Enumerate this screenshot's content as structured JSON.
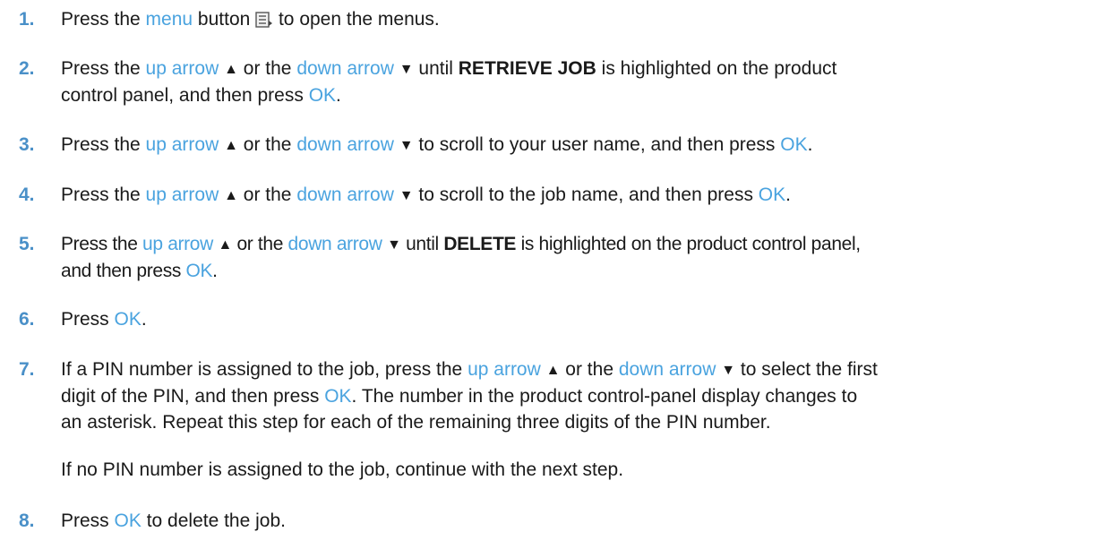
{
  "steps": [
    {
      "num": "1.",
      "t1": "Press the ",
      "link1": "menu",
      "t2": " button ",
      "t3": " to open the menus.",
      "icon": "menu-icon"
    },
    {
      "num": "2.",
      "t1": "Press the ",
      "link1": "up arrow",
      "t2": " or the ",
      "link2": "down arrow",
      "t3": " until ",
      "bold": "RETRIEVE JOB",
      "t4": " is highlighted on the product",
      "line2": "control panel, and then press ",
      "ok": "OK",
      "end": "."
    },
    {
      "num": "3.",
      "t1": "Press the ",
      "link1": "up arrow",
      "t2": " or the ",
      "link2": "down arrow",
      "t3": " to scroll to your user name, and then press ",
      "ok": "OK",
      "end": "."
    },
    {
      "num": "4.",
      "t1": "Press the ",
      "link1": "up arrow",
      "t2": " or the ",
      "link2": "down arrow",
      "t3": " to scroll to the job name, and then press ",
      "ok": "OK",
      "end": "."
    },
    {
      "num": "5.",
      "t1": "Press the ",
      "link1": "up arrow",
      "t2": " or the ",
      "link2": "down arrow",
      "t3": " until ",
      "bold": "DELETE",
      "t4": " is highlighted on the product control panel,",
      "line2": "and then press ",
      "ok": "OK",
      "end": "."
    },
    {
      "num": "6.",
      "t1": "Press ",
      "ok": "OK",
      "end": "."
    },
    {
      "num": "7.",
      "t1": "If a PIN number is assigned to the job, press the ",
      "link1": "up arrow",
      "t2": " or the ",
      "link2": "down arrow",
      "t3": " to select the first",
      "line2": "digit of the PIN, and then press ",
      "ok": "OK",
      "line2b": ". The number in the product control-panel display changes to",
      "line3": "an asterisk. Repeat this step for each of the remaining three digits of the PIN number.",
      "para2": "If no PIN number is assigned to the job, continue with the next step."
    },
    {
      "num": "8.",
      "t1": "Press ",
      "ok": "OK",
      "end": " to delete the job."
    }
  ],
  "glyphs": {
    "up": "▲",
    "down": "▼"
  }
}
